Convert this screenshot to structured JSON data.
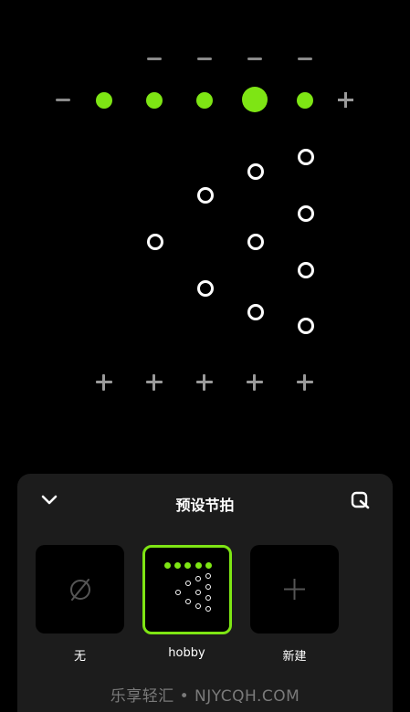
{
  "panel": {
    "title": "预设节拍",
    "presets": [
      {
        "label": "无",
        "selected": false
      },
      {
        "label": "hobby",
        "selected": true
      },
      {
        "label": "新建",
        "selected": false
      }
    ]
  },
  "watermark": "乐享轻汇 • NJYCQH.COM",
  "colors": {
    "accent": "#7ee514",
    "background": "#000000",
    "panel": "#1c1c1c"
  }
}
